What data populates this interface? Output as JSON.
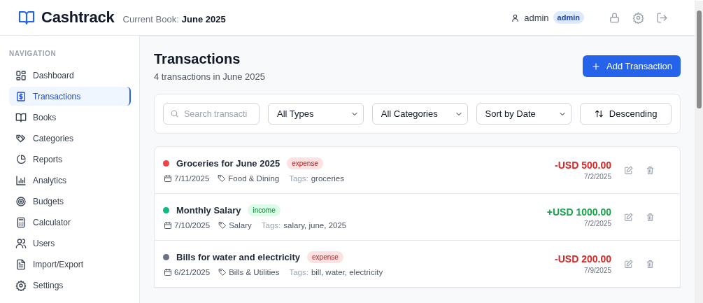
{
  "header": {
    "app_name": "Cashtrack",
    "book_label": "Current Book:",
    "book_name": "June 2025",
    "user": "admin",
    "role_badge": "admin"
  },
  "sidebar": {
    "heading": "NAVIGATION",
    "items": [
      {
        "label": "Dashboard",
        "selected": false
      },
      {
        "label": "Transactions",
        "selected": true
      },
      {
        "label": "Books",
        "selected": false
      },
      {
        "label": "Categories",
        "selected": false
      },
      {
        "label": "Reports",
        "selected": false
      },
      {
        "label": "Analytics",
        "selected": false
      },
      {
        "label": "Budgets",
        "selected": false
      },
      {
        "label": "Calculator",
        "selected": false
      },
      {
        "label": "Users",
        "selected": false
      },
      {
        "label": "Import/Export",
        "selected": false
      },
      {
        "label": "Settings",
        "selected": false
      }
    ]
  },
  "page": {
    "title": "Transactions",
    "subtitle": "4 transactions in June 2025",
    "add_button": "Add Transaction"
  },
  "filters": {
    "search": {
      "placeholder": "Search transacti"
    },
    "type_select": "All Types",
    "category_select": "All Categories",
    "sort_select": "Sort by Date",
    "order_button": "Descending"
  },
  "transactions": [
    {
      "title": "Groceries for June 2025",
      "type": "expense",
      "color": "#ef4444",
      "date": "7/11/2025",
      "category": "Food & Dining",
      "tags_label": "Tags:",
      "tags": "groceries",
      "amount": "-USD 500.00",
      "created": "7/2/2025"
    },
    {
      "title": "Monthly Salary",
      "type": "income",
      "color": "#10b981",
      "date": "7/10/2025",
      "category": "Salary",
      "tags_label": "Tags:",
      "tags": "salary, june, 2025",
      "amount": "+USD 1000.00",
      "created": "7/2/2025"
    },
    {
      "title": "Bills for water and electricity",
      "type": "expense",
      "color": "#6b7280",
      "date": "6/21/2025",
      "category": "Bills & Utilities",
      "tags_label": "Tags:",
      "tags": "bill, water, electricity",
      "amount": "-USD 200.00",
      "created": "7/9/2025"
    }
  ]
}
